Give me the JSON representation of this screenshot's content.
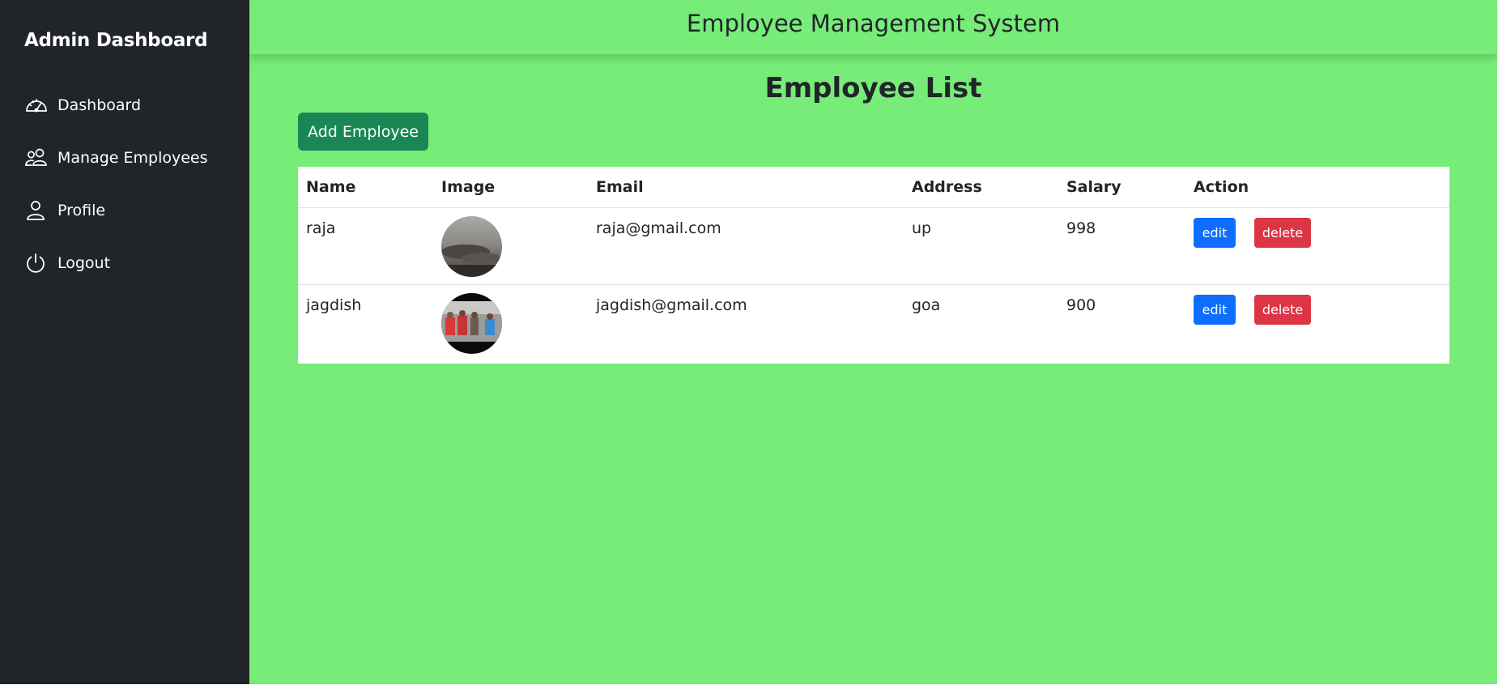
{
  "sidebar": {
    "brand": "Admin Dashboard",
    "items": [
      {
        "label": "Dashboard",
        "icon": "speedometer-icon"
      },
      {
        "label": "Manage Employees",
        "icon": "people-icon"
      },
      {
        "label": "Profile",
        "icon": "person-icon"
      },
      {
        "label": "Logout",
        "icon": "power-icon"
      }
    ]
  },
  "header": {
    "title": "Employee Management System"
  },
  "main": {
    "page_title": "Employee List",
    "add_button_label": "Add Employee",
    "table": {
      "columns": [
        "Name",
        "Image",
        "Email",
        "Address",
        "Salary",
        "Action"
      ],
      "rows": [
        {
          "name": "raja",
          "email": "raja@gmail.com",
          "address": "up",
          "salary": "998",
          "edit_label": "edit",
          "delete_label": "delete"
        },
        {
          "name": "jagdish",
          "email": "jagdish@gmail.com",
          "address": "goa",
          "salary": "900",
          "edit_label": "edit",
          "delete_label": "delete"
        }
      ]
    }
  },
  "colors": {
    "sidebar_bg": "#212529",
    "main_bg": "#77ec78",
    "add_button": "#198754",
    "edit_button": "#0d6efd",
    "delete_button": "#dc3545"
  }
}
